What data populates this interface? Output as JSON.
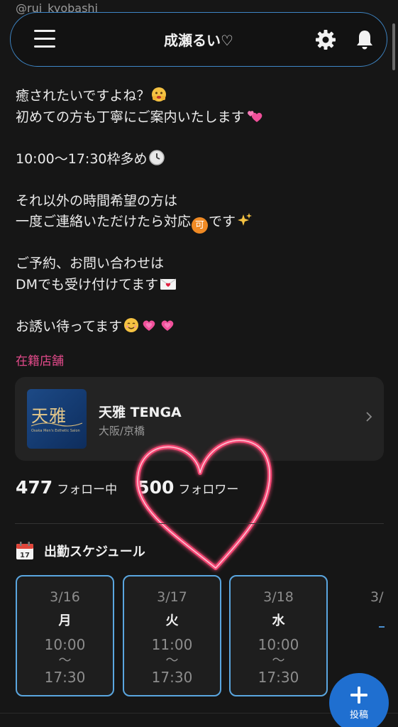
{
  "profile": {
    "handle": "@rui_kyobashi",
    "name": "成瀬るい♡"
  },
  "bio": {
    "line1": "癒されたいですよね？",
    "line2": "初めての方も丁寧にご案内いたします",
    "line3": "10:00〜17:30枠多め",
    "line4": "それ以外の時間希望の方は",
    "line5": "一度ご連絡いただけたら対応",
    "line5b": "可",
    "line5c": "です",
    "line6": "ご予約、お問い合わせは",
    "line7": "DMでも受け付けてます",
    "line8": "お誘い待ってます"
  },
  "shop": {
    "section_label": "在籍店舗",
    "name": "天雅 TENGA",
    "area": "大阪/京橋",
    "logo_text": "天雅",
    "logo_small": "Osaka Men's Esthetic Salon"
  },
  "follow": {
    "following_count": "477",
    "following_label": "フォロー中",
    "followers_count": "500",
    "followers_label": "フォロワー"
  },
  "schedule": {
    "title": "出勤スケジュール",
    "days": [
      {
        "date": "3/16",
        "dow": "月",
        "start": "10:00",
        "sep": "〜",
        "end": "17:30"
      },
      {
        "date": "3/17",
        "dow": "火",
        "start": "11:00",
        "sep": "〜",
        "end": "17:30"
      },
      {
        "date": "3/18",
        "dow": "水",
        "start": "10:00",
        "sep": "〜",
        "end": "17:30"
      }
    ],
    "peek_date": "3/"
  },
  "fab": {
    "label": "投稿"
  },
  "colors": {
    "background": "#161616",
    "accent_blue": "#3e86c6",
    "pink_label": "#e24a8a",
    "heart": "#ff3b6b",
    "fab": "#1f6fd0"
  },
  "icons": [
    "menu-icon",
    "gear-icon",
    "bell-icon",
    "chevron-right-icon",
    "calendar-icon",
    "plus-icon",
    "heart-drawing"
  ]
}
